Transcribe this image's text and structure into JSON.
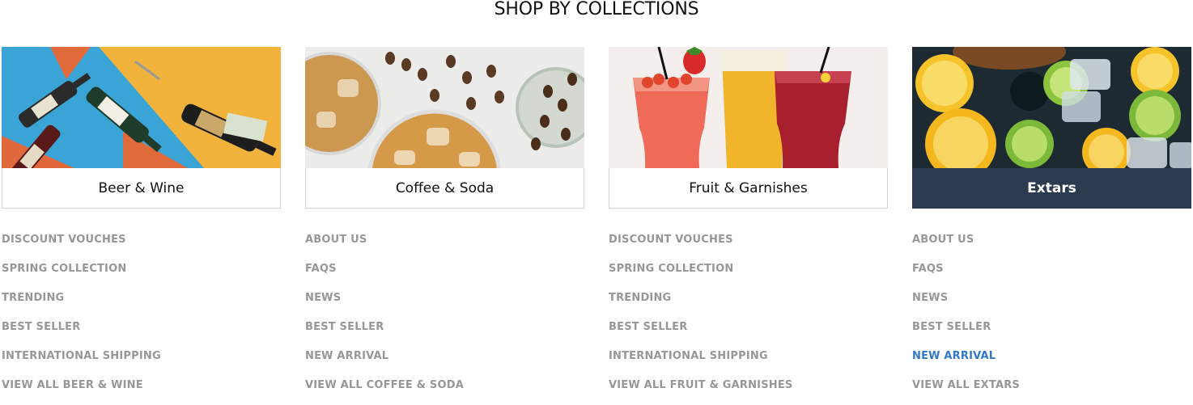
{
  "section": {
    "title": "SHOP BY COLLECTIONS"
  },
  "collections": [
    {
      "label": "Beer & Wine",
      "links": [
        "DISCOUNT VOUCHES",
        "SPRING COLLECTION",
        "TRENDING",
        "BEST SELLER",
        "INTERNATIONAL SHIPPING"
      ],
      "view_all": "VIEW ALL BEER & WINE"
    },
    {
      "label": "Coffee & Soda",
      "links": [
        "ABOUT US",
        "FAQS",
        "NEWS",
        "BEST SELLER",
        "NEW ARRIVAL"
      ],
      "view_all": "VIEW ALL COFFEE & SODA"
    },
    {
      "label": "Fruit & Garnishes",
      "links": [
        "DISCOUNT VOUCHES",
        "SPRING COLLECTION",
        "TRENDING",
        "BEST SELLER",
        "INTERNATIONAL SHIPPING"
      ],
      "view_all": "VIEW ALL FRUIT & GARNISHES"
    },
    {
      "label": "Extars",
      "links": [
        "ABOUT US",
        "FAQS",
        "NEWS",
        "BEST SELLER",
        "NEW ARRIVAL"
      ],
      "view_all": "VIEW ALL EXTARS",
      "active": true,
      "highlighted_link": "NEW ARRIVAL"
    }
  ],
  "colors": {
    "link_grey": "#979797",
    "link_blue": "#3178c6",
    "active_card_bg": "#2c3a4f",
    "card_border": "#d4d4d4"
  }
}
